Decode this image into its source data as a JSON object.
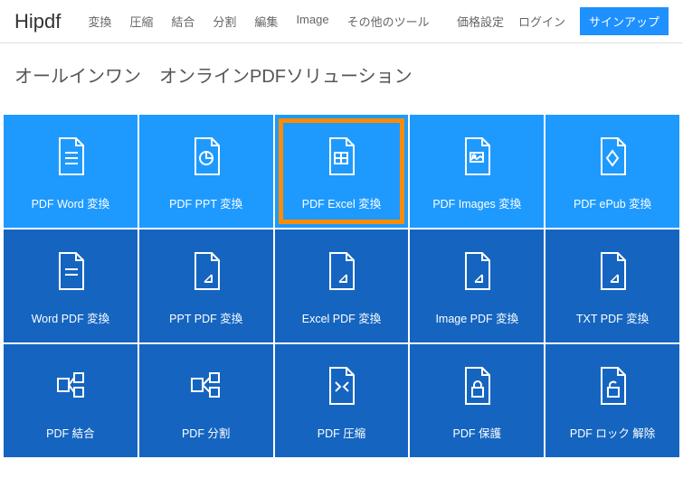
{
  "header": {
    "logo": "Hipdf",
    "nav": [
      "変換",
      "圧縮",
      "結合",
      "分割",
      "編集",
      "Image",
      "その他のツール"
    ],
    "pricing": "価格設定",
    "login": "ログイン",
    "signup": "サインアップ"
  },
  "hero": {
    "title": "オールインワン　オンラインPDFソリューション"
  },
  "tiles": {
    "row1": [
      {
        "label": "PDF Word 変換",
        "icon": "doc-lines"
      },
      {
        "label": "PDF PPT 変換",
        "icon": "doc-chart"
      },
      {
        "label": "PDF Excel 変換",
        "icon": "doc-grid",
        "highlighted": true
      },
      {
        "label": "PDF Images 変換",
        "icon": "doc-image"
      },
      {
        "label": "PDF ePub 変換",
        "icon": "doc-diamond"
      }
    ],
    "row2": [
      {
        "label": "Word PDF 変換",
        "icon": "doc-lines"
      },
      {
        "label": "PPT PDF 変換",
        "icon": "doc-corner"
      },
      {
        "label": "Excel PDF 変換",
        "icon": "doc-corner"
      },
      {
        "label": "Image PDF 変換",
        "icon": "doc-corner"
      },
      {
        "label": "TXT PDF 変換",
        "icon": "doc-corner"
      }
    ],
    "row3": [
      {
        "label": "PDF 結合",
        "icon": "merge"
      },
      {
        "label": "PDF 分割",
        "icon": "split"
      },
      {
        "label": "PDF 圧縮",
        "icon": "compress"
      },
      {
        "label": "PDF 保護",
        "icon": "lock"
      },
      {
        "label": "PDF ロック 解除",
        "icon": "unlock"
      }
    ]
  }
}
